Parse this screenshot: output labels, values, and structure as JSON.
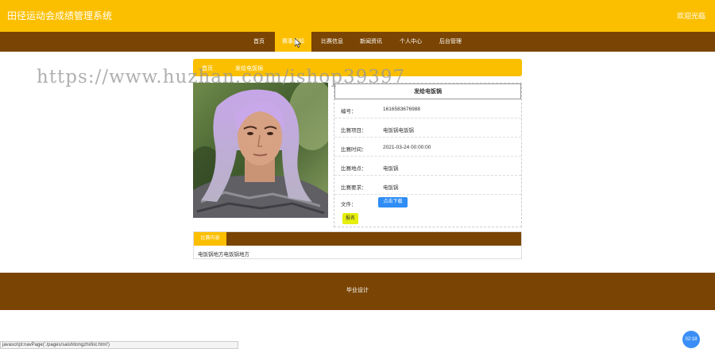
{
  "header": {
    "site_title": "田径运动会成绩管理系统",
    "welcome": "欢迎光临"
  },
  "nav": {
    "items": [
      {
        "label": "首页"
      },
      {
        "label": "赛事通知"
      },
      {
        "label": "比赛信息"
      },
      {
        "label": "新闻资讯"
      },
      {
        "label": "个人中心"
      },
      {
        "label": "后台管理"
      }
    ],
    "active_index": 1
  },
  "breadcrumb": {
    "home": "首页",
    "current": "发给电饭锅"
  },
  "watermark": "https://www.huzhan.com/ishop39397",
  "detail": {
    "title": "发给电饭锅",
    "rows": [
      {
        "label": "编号：",
        "value": "1616583676988"
      },
      {
        "label": "比赛项目：",
        "value": "电饭锅电饭锅"
      },
      {
        "label": "比赛时间：",
        "value": "2021-03-24 00:00:00"
      },
      {
        "label": "比赛地点：",
        "value": "电饭锅"
      },
      {
        "label": "比赛要求：",
        "value": "电饭锅"
      },
      {
        "label": "文件："
      }
    ],
    "download_label": "点击下载",
    "signup_label": "报名"
  },
  "content": {
    "tab_label": "比赛内容",
    "text": "电饭锅地方电饭锅地方"
  },
  "footer": {
    "text": "毕业设计"
  },
  "statusbar": {
    "text": "javascript:navPage('./pages/saishitongzhi/list.html')"
  },
  "timer": {
    "text": "02:18"
  },
  "colors": {
    "primary": "#fbbf00",
    "nav_bg": "#7a4504",
    "download": "#2f8df5",
    "signup": "#e6ee0b"
  }
}
